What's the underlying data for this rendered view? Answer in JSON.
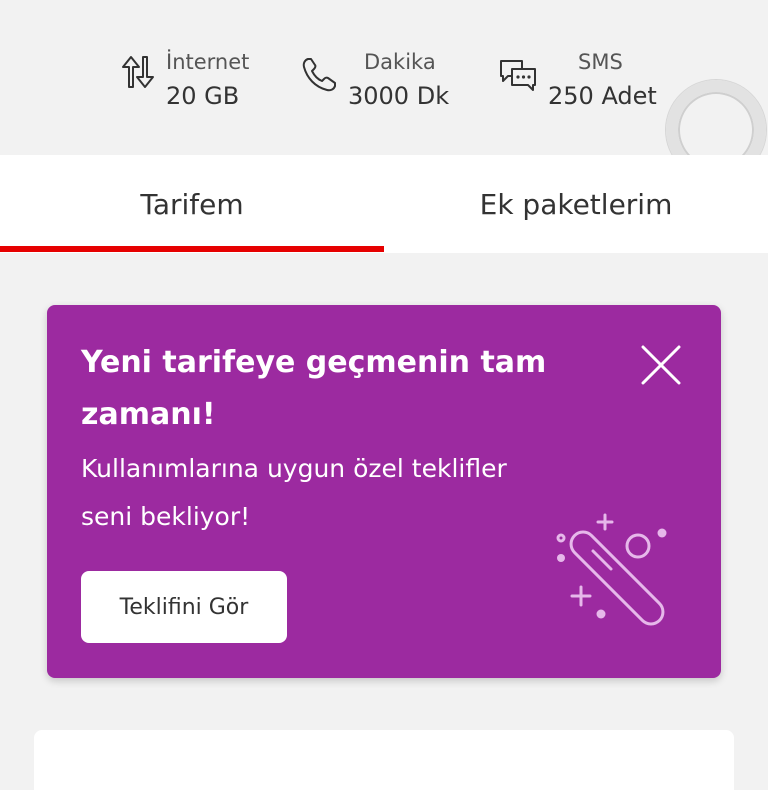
{
  "usage": {
    "internet": {
      "label": "İnternet",
      "value": "20 GB",
      "icon": "data-transfer-icon"
    },
    "minutes": {
      "label": "Dakika",
      "value": "3000 Dk",
      "icon": "phone-icon"
    },
    "sms": {
      "label": "SMS",
      "value": "250 Adet",
      "icon": "chat-bubbles-icon"
    }
  },
  "tabs": [
    {
      "label": "Tarifem",
      "active": true
    },
    {
      "label": "Ek paketlerim",
      "active": false
    }
  ],
  "promo": {
    "title": "Yeni tarifeye geçmenin tam zamanı!",
    "description": "Kullanımlarına uygun özel teklifler seni bekliyor!",
    "button_label": "Teklifini Gör",
    "background": "#9c2aa0",
    "art_icon": "magic-wand-icon",
    "close_icon": "close-icon"
  },
  "colors": {
    "accent": "#e60000",
    "page_background": "#f2f2f2"
  }
}
